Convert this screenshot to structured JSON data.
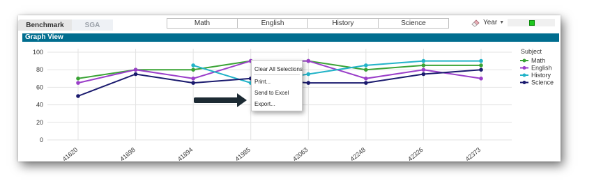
{
  "tabs": [
    {
      "label": "Benchmark",
      "active": true
    },
    {
      "label": "SGA",
      "active": false
    }
  ],
  "filters": [
    "Math",
    "English",
    "History",
    "Science"
  ],
  "year": {
    "label": "Year",
    "icon": "eraser-icon",
    "indicator_color": "#1ec81e"
  },
  "panel": {
    "title": "Graph View",
    "title_bar_color": "#006d8f"
  },
  "chart_data": {
    "type": "line",
    "categories": [
      "41620",
      "41698",
      "41894",
      "41985",
      "42063",
      "42248",
      "42326",
      "42373"
    ],
    "ylim": [
      0,
      100
    ],
    "yticks": [
      0,
      20,
      40,
      60,
      80,
      100
    ],
    "grid": true,
    "legend": {
      "title": "Subject",
      "placement": "right"
    },
    "series": [
      {
        "name": "Math",
        "color": "#3aa335",
        "values": [
          70,
          80,
          80,
          90,
          90,
          80,
          85,
          85
        ]
      },
      {
        "name": "English",
        "color": "#9b3fc9",
        "values": [
          65,
          80,
          70,
          90,
          90,
          70,
          80,
          70
        ]
      },
      {
        "name": "History",
        "color": "#22b3c8",
        "values": [
          null,
          null,
          85,
          65,
          75,
          85,
          90,
          90
        ]
      },
      {
        "name": "Science",
        "color": "#1a1a6e",
        "values": [
          50,
          75,
          65,
          70,
          65,
          65,
          75,
          80
        ]
      }
    ]
  },
  "context_menu": {
    "items": [
      "Clear All Selections",
      "Print...",
      "Send to Excel",
      "Export..."
    ]
  },
  "arrow": {
    "color": "#1c2a33"
  }
}
